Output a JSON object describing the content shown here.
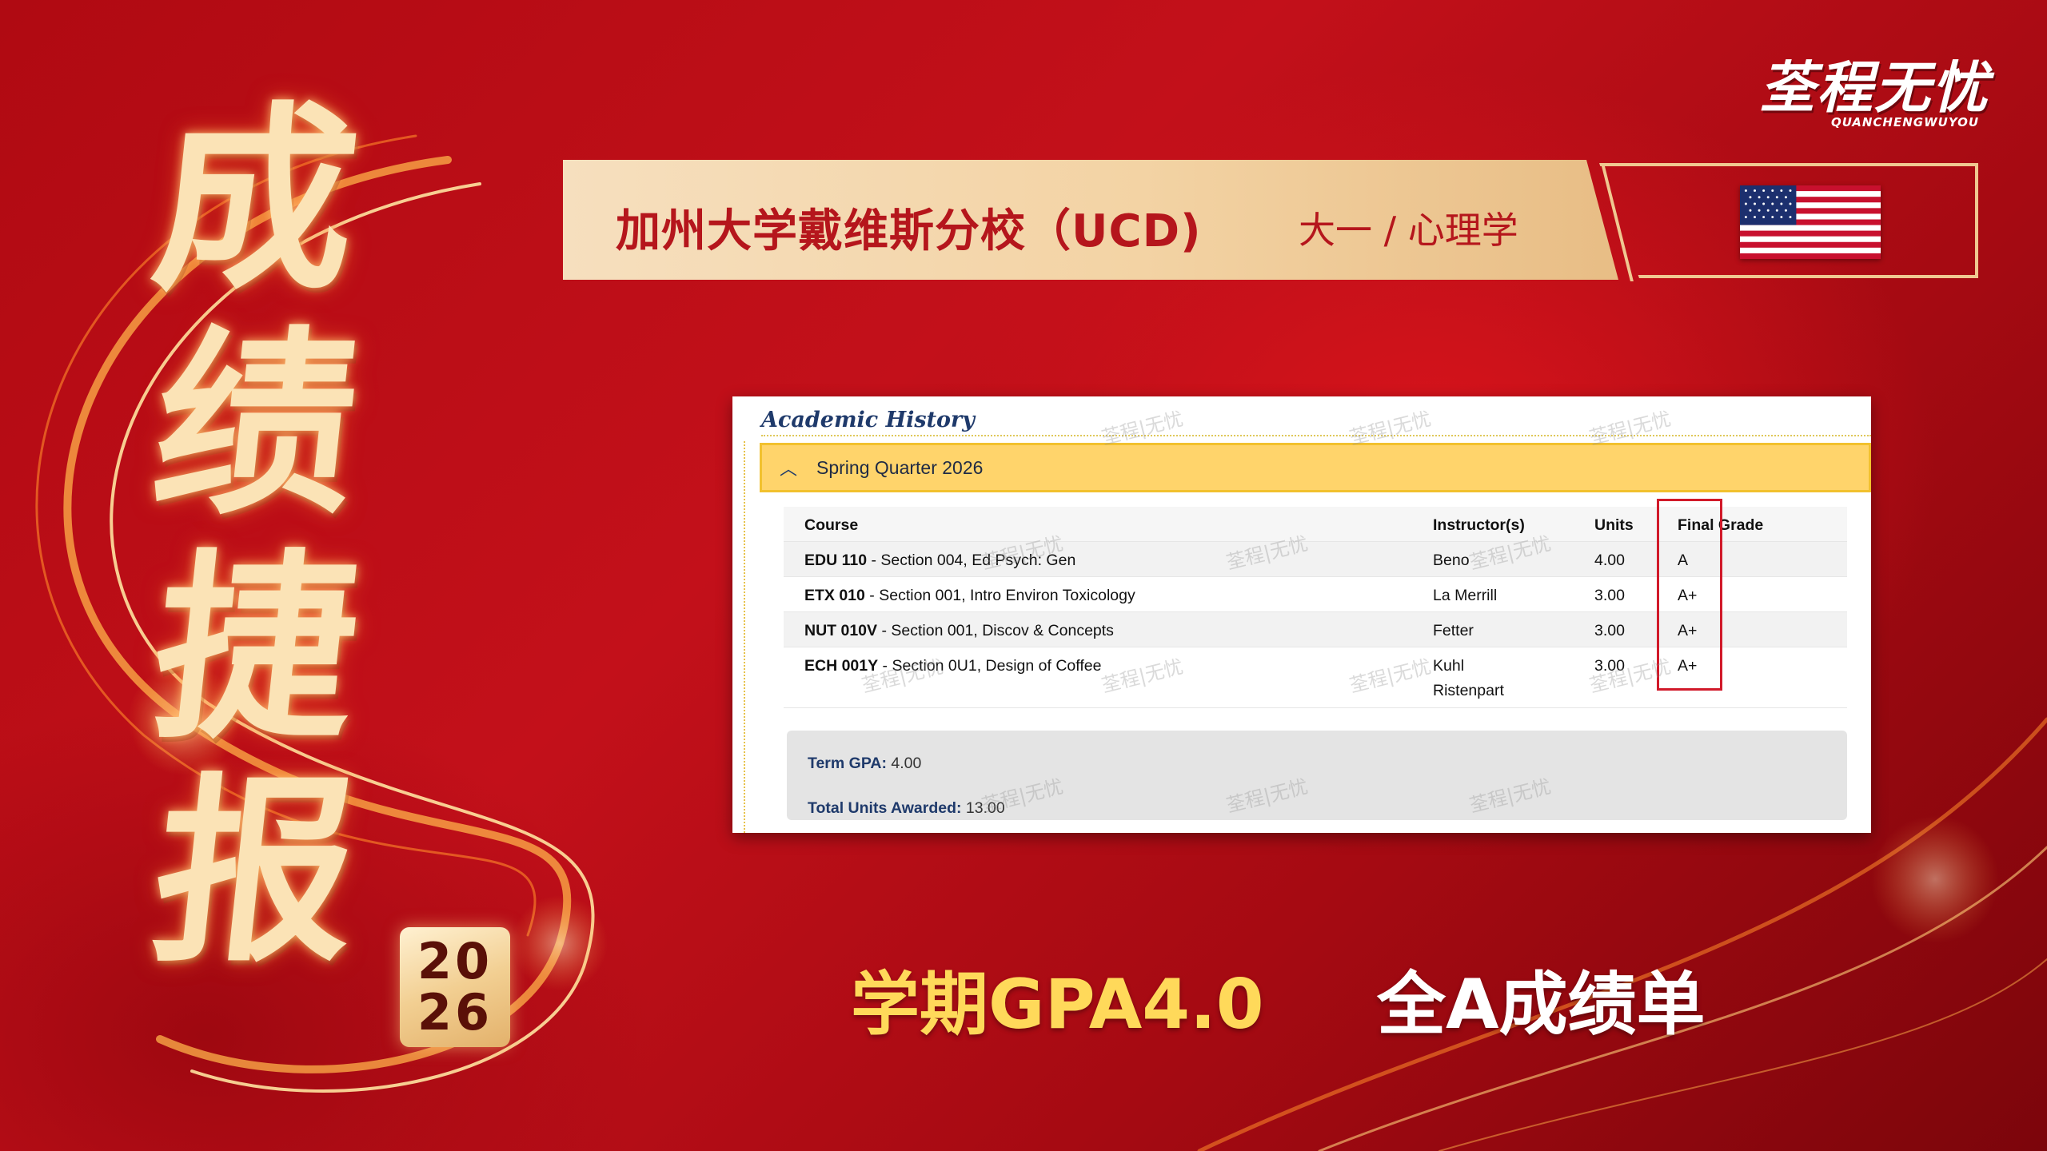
{
  "poster": {
    "big_title": [
      "成",
      "绩",
      "捷",
      "报"
    ],
    "year_badge": [
      "20",
      "26"
    ],
    "logo": {
      "main": "荃程无忧",
      "sub": "QUANCHENGWUYOU"
    },
    "banner": {
      "university": "加州大学戴维斯分校（UCD)",
      "major": "大一 / 心理学"
    },
    "flag": "us-flag-icon",
    "captions": {
      "gpa": "学期GPA4.0",
      "all_a": "全A成绩单"
    },
    "colors": {
      "background": "#c3101a",
      "gold": "#ffd95a",
      "banner": "#f3d3a4",
      "banner_text": "#b5161c"
    }
  },
  "transcript": {
    "title": "Academic History",
    "quarter": "Spring Quarter 2026",
    "headers": {
      "course": "Course",
      "instructor": "Instructor(s)",
      "units": "Units",
      "grade": "Final Grade"
    },
    "rows": [
      {
        "code": "EDU 110",
        "rest": " - Section 004, Ed Psych: Gen",
        "instructor": "Beno",
        "instructor2": "",
        "units": "4.00",
        "grade": "A"
      },
      {
        "code": "ETX 010",
        "rest": " - Section 001, Intro Environ Toxicology",
        "instructor": "La Merrill",
        "instructor2": "",
        "units": "3.00",
        "grade": "A+"
      },
      {
        "code": "NUT 010V",
        "rest": " - Section 001, Discov & Concepts",
        "instructor": "Fetter",
        "instructor2": "",
        "units": "3.00",
        "grade": "A+"
      },
      {
        "code": "ECH 001Y",
        "rest": " - Section 0U1, Design of Coffee",
        "instructor": "Kuhl",
        "instructor2": "Ristenpart",
        "units": "3.00",
        "grade": "A+"
      }
    ],
    "summary": {
      "term_gpa_label": "Term GPA:",
      "term_gpa_value": " 4.00",
      "total_units_label": "Total Units Awarded:",
      "total_units_value": " 13.00"
    },
    "watermark": "荃程|无忧"
  }
}
